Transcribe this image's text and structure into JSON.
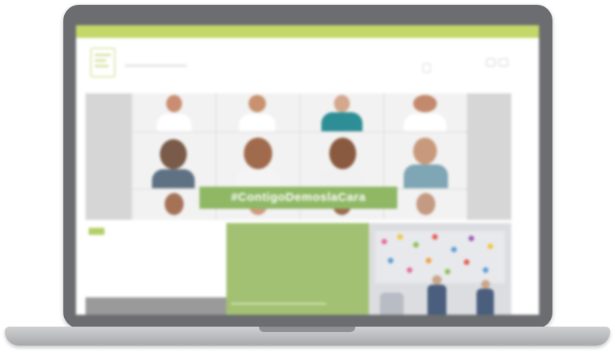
{
  "site": {
    "topbar_text": "",
    "search_placeholder": "",
    "header_buttons": [
      "",
      ""
    ],
    "nav": [
      "",
      "",
      "",
      "",
      "",
      ""
    ],
    "hero_hashtag": "#ContigoDemoslaCara",
    "left_panel": {
      "tag": "",
      "text": "",
      "footer": ""
    },
    "mid_panel": {
      "small_label": "",
      "caption": ""
    }
  },
  "colors": {
    "accent_green": "#c4d86a",
    "hashtag_bg": "#8fb865",
    "mid_panel": "#a3c172",
    "bezel": "#6b6d70"
  }
}
